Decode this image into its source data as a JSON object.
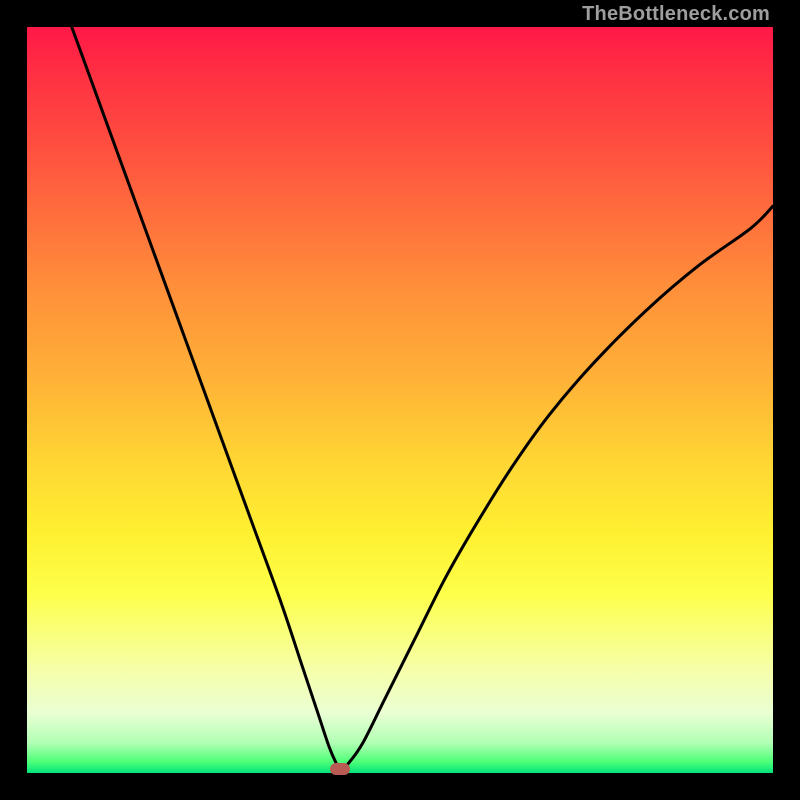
{
  "watermark": "TheBottleneck.com",
  "chart_data": {
    "type": "line",
    "title": "",
    "xlabel": "",
    "ylabel": "",
    "xlim": [
      0,
      100
    ],
    "ylim": [
      0,
      100
    ],
    "grid": false,
    "legend": false,
    "background_gradient": {
      "top_color": "#ff1848",
      "mid_color": "#fff031",
      "bottom_color": "#00e37a"
    },
    "series": [
      {
        "name": "bottleneck-curve",
        "color": "#000000",
        "x": [
          6,
          10,
          14,
          18,
          22,
          26,
          30,
          34,
          37,
          39,
          40.5,
          41.5,
          42,
          43,
          45,
          48,
          52,
          56,
          60,
          65,
          70,
          76,
          83,
          90,
          97,
          100
        ],
        "y": [
          100,
          89,
          78,
          67,
          56,
          45,
          34,
          23,
          14,
          8,
          3.5,
          1.2,
          0.5,
          1.2,
          4,
          10,
          18,
          26,
          33,
          41,
          48,
          55,
          62,
          68,
          73,
          76
        ]
      }
    ],
    "marker": {
      "x": 42,
      "y": 0.6,
      "color": "#b95a55"
    }
  }
}
